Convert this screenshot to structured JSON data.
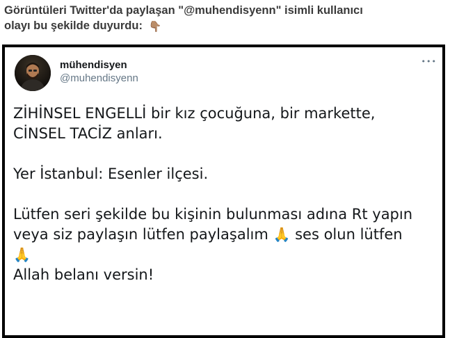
{
  "caption": {
    "line1": "Görüntüleri Twitter'da paylaşan \"@muhendisyenn\" isimli kullanıcı",
    "line2": "olayı bu şekilde duyurdu:",
    "emoji": "👇🏽"
  },
  "tweet": {
    "user": {
      "display_name": "mühendisyen",
      "handle": "@muhendisyenn"
    },
    "more_icon": "•••",
    "text": {
      "line1": "ZİHİNSEL ENGELLİ bir kız çocuğuna, bir markette,",
      "line2": "CİNSEL TACİZ anları.",
      "line3": "Yer İstanbul: Esenler ilçesi.",
      "line4": "Lütfen seri şekilde bu kişinin bulunması adına Rt yapın",
      "line5_a": "veya siz paylaşın lütfen paylaşalım",
      "line5_b": "ses olun lütfen",
      "line7": "Allah belanı versin!"
    },
    "pray_emoji": "🙏"
  },
  "colors": {
    "caption_text": "#3a3a3a",
    "frame_border": "#000000",
    "tweet_text": "#14171a",
    "handle_text": "#657786"
  },
  "icons": {
    "pointer": "pointing-down-hand-icon",
    "more": "more-options-icon",
    "pray": "folded-hands-icon"
  }
}
